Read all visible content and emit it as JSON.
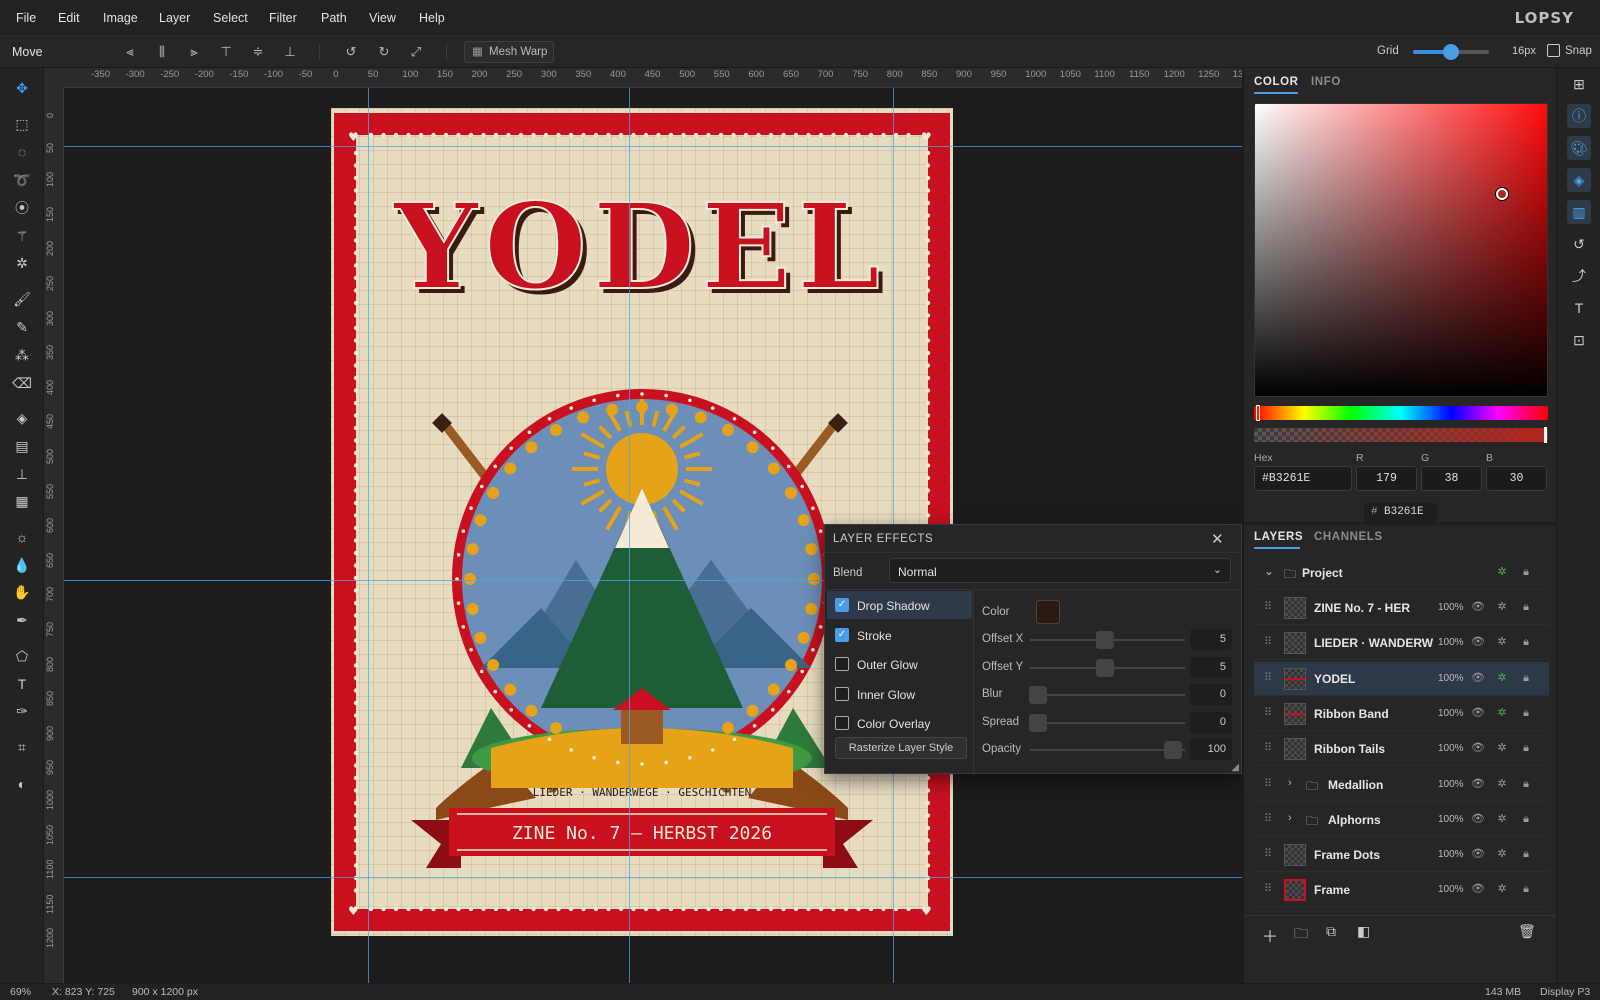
{
  "menu": [
    "File",
    "Edit",
    "Image",
    "Layer",
    "Select",
    "Filter",
    "Path",
    "View",
    "Help"
  ],
  "app_logo": "LOPSY",
  "options": {
    "tool_name": "Move",
    "mesh_warp_label": "Mesh Warp",
    "grid_label": "Grid",
    "grid_value": 0.5,
    "grid_size": "16px",
    "snap_label": "Snap"
  },
  "ruler": {
    "top_ticks": [
      "-350",
      "-300",
      "-250",
      "-200",
      "-150",
      "-100",
      "-50",
      "0",
      "50",
      "100",
      "150",
      "200",
      "250",
      "300",
      "350",
      "400",
      "450",
      "500",
      "550",
      "600",
      "650",
      "700",
      "750",
      "800",
      "850",
      "900",
      "950",
      "1000",
      "1050",
      "1100",
      "1150",
      "1200",
      "1250",
      "13"
    ],
    "left_ticks": [
      "0",
      "50",
      "100",
      "150",
      "200",
      "250",
      "300",
      "350",
      "400",
      "450",
      "500",
      "550",
      "600",
      "650",
      "700",
      "750",
      "800",
      "850",
      "900",
      "950",
      "1000",
      "1050",
      "1100",
      "1150",
      "1200"
    ]
  },
  "artwork": {
    "title": "YODEL",
    "subtitle": "LIEDER · WANDERWEGE · GESCHICHTEN",
    "banner": "ZINE No. 7 — HERBST 2026",
    "colors": {
      "red": "#c8101e",
      "cream": "#e8dcc0",
      "sky": "#6b8fb8",
      "sun": "#e6a317",
      "forest": "#1e5e37",
      "horn": "#9a5a22"
    }
  },
  "color_panel": {
    "tabs": [
      "COLOR",
      "INFO"
    ],
    "hex_label": "Hex",
    "hex_value": "#B3261E",
    "r_label": "R",
    "r_value": "179",
    "g_label": "G",
    "g_value": "38",
    "b_label": "B",
    "b_value": "30",
    "swatch_hash": "#",
    "swatch_value": "B3261E",
    "current_color": "#B3261E"
  },
  "layer_effects": {
    "title": "LAYER EFFECTS",
    "blend_label": "Blend",
    "blend_value": "Normal",
    "effects": [
      {
        "label": "Drop Shadow",
        "checked": true
      },
      {
        "label": "Stroke",
        "checked": true
      },
      {
        "label": "Outer Glow",
        "checked": false
      },
      {
        "label": "Inner Glow",
        "checked": false
      },
      {
        "label": "Color Overlay",
        "checked": false
      }
    ],
    "rasterize_label": "Rasterize Layer Style",
    "color_label": "Color",
    "shadow_color": "#2a1a12",
    "params": [
      {
        "label": "Offset X",
        "value": "5"
      },
      {
        "label": "Offset Y",
        "value": "5"
      },
      {
        "label": "Blur",
        "value": "0"
      },
      {
        "label": "Spread",
        "value": "0"
      },
      {
        "label": "Opacity",
        "value": "100"
      }
    ]
  },
  "layers_panel": {
    "tabs": [
      "LAYERS",
      "CHANNELS"
    ],
    "group_name": "Project",
    "layers": [
      {
        "name": "ZINE No. 7 - HER",
        "opacity": "100%"
      },
      {
        "name": "LIEDER · WANDERW",
        "opacity": "100%"
      },
      {
        "name": "YODEL",
        "opacity": "100%"
      },
      {
        "name": "Ribbon Band",
        "opacity": "100%"
      },
      {
        "name": "Ribbon Tails",
        "opacity": "100%"
      },
      {
        "name": "Medallion",
        "opacity": "100%"
      },
      {
        "name": "Alphorns",
        "opacity": "100%"
      },
      {
        "name": "Frame Dots",
        "opacity": "100%"
      },
      {
        "name": "Frame",
        "opacity": "100%"
      }
    ]
  },
  "status": {
    "zoom": "69%",
    "coords": "X: 823 Y: 725",
    "doc_size": "900 x 1200 px",
    "memory": "143 MB",
    "profile": "Display P3"
  }
}
